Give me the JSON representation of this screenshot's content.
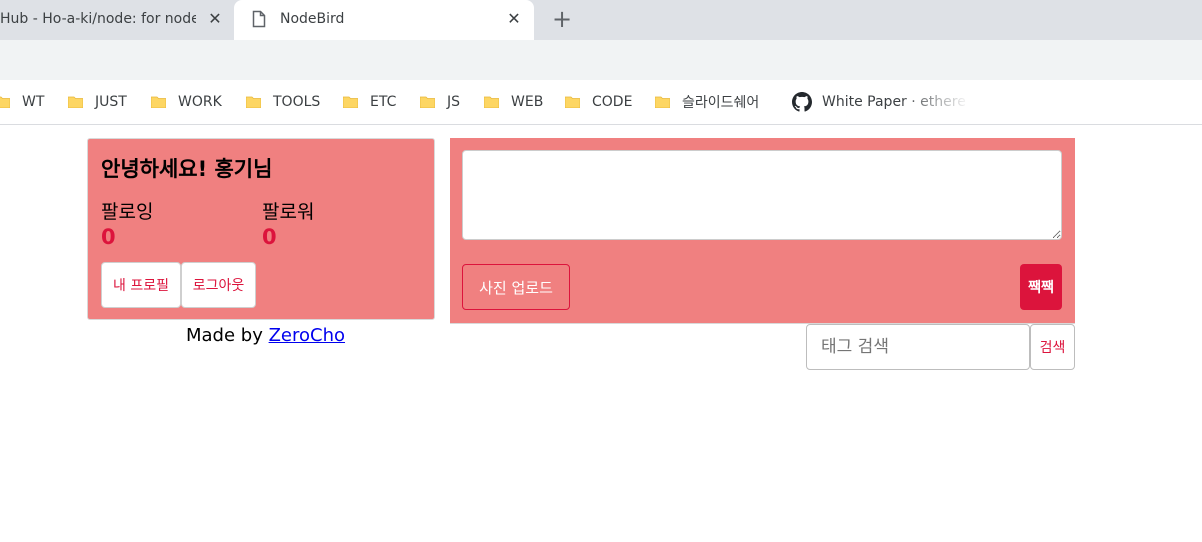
{
  "browser": {
    "tabs": [
      {
        "title": "Hub - Ho-a-ki/node: for node",
        "active": false,
        "close_label": "✕"
      },
      {
        "title": "NodeBird",
        "active": true,
        "close_label": "✕"
      }
    ],
    "new_tab_label": "+",
    "bookmarks": [
      {
        "label": "WT",
        "icon": "folder-icon"
      },
      {
        "label": "JUST",
        "icon": "folder-icon"
      },
      {
        "label": "WORK",
        "icon": "folder-icon"
      },
      {
        "label": "TOOLS",
        "icon": "folder-icon"
      },
      {
        "label": "ETC",
        "icon": "folder-icon"
      },
      {
        "label": "JS",
        "icon": "folder-icon"
      },
      {
        "label": "WEB",
        "icon": "folder-icon"
      },
      {
        "label": "CODE",
        "icon": "folder-icon"
      },
      {
        "label": "슬라이드쉐어",
        "icon": "folder-icon"
      },
      {
        "label": "White Paper · ethere",
        "icon": "github-icon"
      }
    ]
  },
  "profile": {
    "greeting": "안녕하세요! 홍기님",
    "following_label": "팔로잉",
    "following_count": "0",
    "followers_label": "팔로워",
    "followers_count": "0",
    "my_profile_button": "내 프로필",
    "logout_button": "로그아웃"
  },
  "footer": {
    "prefix": "Made by ",
    "link": "ZeroCho"
  },
  "post_form": {
    "textarea_value": "",
    "upload_button": "사진 업로드",
    "submit_button": "짹짹"
  },
  "tag_search": {
    "placeholder": "태그 검색",
    "button": "검색"
  },
  "colors": {
    "card_background": "#f08080",
    "accent": "#dc143c",
    "tabstrip": "#dee1e6",
    "toolbar": "#f1f3f4"
  }
}
